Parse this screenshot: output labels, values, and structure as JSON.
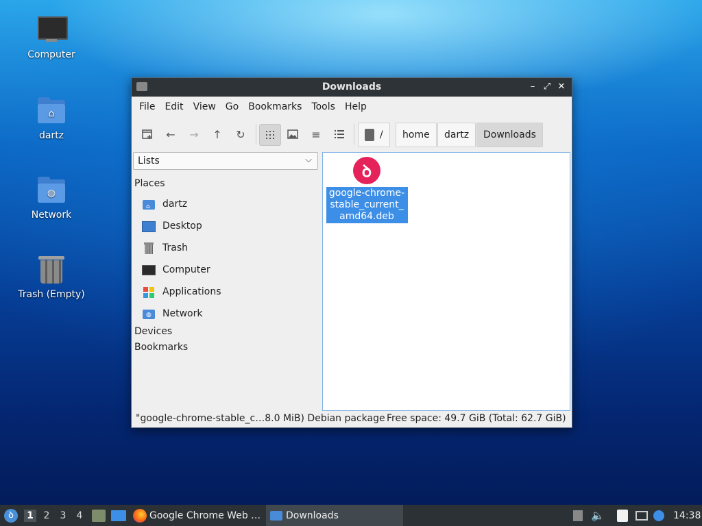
{
  "desktop": {
    "icons": [
      {
        "label": "Computer"
      },
      {
        "label": "dartz"
      },
      {
        "label": "Network"
      },
      {
        "label": "Trash (Empty)"
      }
    ]
  },
  "window": {
    "title": "Downloads",
    "controls": {
      "minimize": "–",
      "maximize": "⤢",
      "close": "✕"
    },
    "menu": [
      "File",
      "Edit",
      "View",
      "Go",
      "Bookmarks",
      "Tools",
      "Help"
    ],
    "breadcrumb": [
      "/",
      "home",
      "dartz",
      "Downloads"
    ],
    "side_pane": {
      "mode": "Lists",
      "places_header": "Places",
      "places": [
        "dartz",
        "Desktop",
        "Trash",
        "Computer",
        "Applications",
        "Network"
      ],
      "devices_header": "Devices",
      "bookmarks_header": "Bookmarks"
    },
    "files": [
      {
        "name": "google-chrome-stable_current_amd64.deb",
        "icon": "debian-package-icon",
        "selected": true
      }
    ],
    "status": {
      "selection": "\"google-chrome-stable_c…8.0 MiB) Debian package",
      "free_space": "Free space: 49.7 GiB (Total: 62.7 GiB)"
    }
  },
  "taskbar": {
    "workspaces": [
      "1",
      "2",
      "3",
      "4"
    ],
    "active_workspace": "1",
    "tasks": [
      {
        "label": "Google Chrome Web …"
      },
      {
        "label": "Downloads"
      }
    ],
    "clock": "14:38"
  },
  "colors": {
    "selection": "#3d8ee6",
    "titlebar": "#2e3338",
    "taskbar": "#2c3135"
  }
}
